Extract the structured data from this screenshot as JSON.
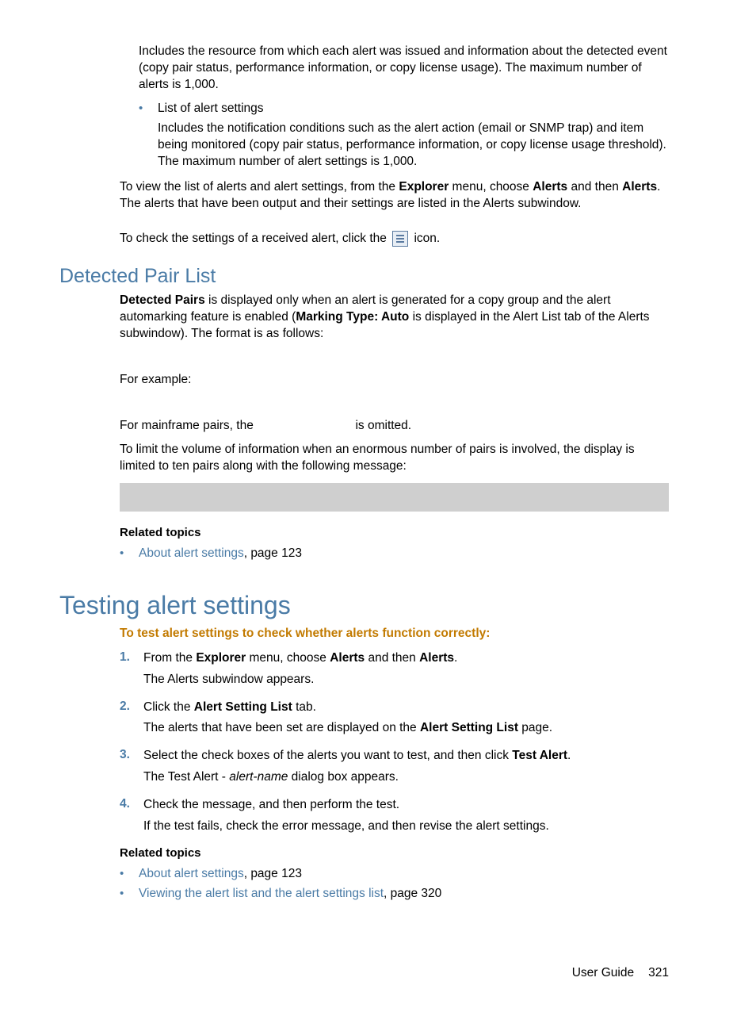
{
  "intro": {
    "para1": "Includes the resource from which each alert was issued and information about the detected event (copy pair status, performance information, or copy license usage). The maximum number of alerts is 1,000.",
    "bullet_label": "List of alert settings",
    "para2": "Includes the notification conditions such as the alert action (email or SNMP trap) and item being monitored (copy pair status, performance information, or copy license usage threshold). The maximum number of alert settings is 1,000.",
    "view_pre": "To view the list of alerts and alert settings, from the ",
    "explorer": "Explorer",
    "view_mid1": " menu, choose ",
    "alerts1": "Alerts",
    "view_mid2": " and then ",
    "alerts2": "Alerts",
    "view_post": ". The alerts that have been output and their settings are listed in the Alerts subwindow.",
    "check_pre": "To check the settings of a received alert, click the ",
    "check_post": " icon."
  },
  "detected": {
    "heading": "Detected Pair List",
    "p1_b1": "Detected Pairs",
    "p1_t1": " is displayed only when an alert is generated for a copy group and the alert automarking feature is enabled (",
    "p1_b2": "Marking Type: Auto",
    "p1_t2": " is displayed in the Alert List tab of the Alerts subwindow). The format is as follows:",
    "example": "For example:",
    "mainframe_pre": "For mainframe pairs, the ",
    "mainframe_post": " is omitted.",
    "limit": "To limit the volume of information when an enormous number of pairs is involved, the display is limited to ten pairs along with the following message:",
    "related_heading": "Related topics",
    "rel1_link": "About alert settings",
    "rel1_post": ", page 123"
  },
  "testing": {
    "heading": "Testing alert settings",
    "lead": "To test alert settings to check whether alerts function correctly:",
    "s1_num": "1.",
    "s1_pre": "From the ",
    "s1_b1": "Explorer",
    "s1_mid1": " menu, choose ",
    "s1_b2": "Alerts",
    "s1_mid2": " and then ",
    "s1_b3": "Alerts",
    "s1_post": ".",
    "s1_sub": "The Alerts subwindow appears.",
    "s2_num": "2.",
    "s2_pre": "Click the ",
    "s2_b1": "Alert Setting List",
    "s2_post": " tab.",
    "s2_sub_pre": "The alerts that have been set are displayed on the ",
    "s2_sub_b": "Alert Setting List",
    "s2_sub_post": " page.",
    "s3_num": "3.",
    "s3_pre": "Select the check boxes of the alerts you want to test, and then click ",
    "s3_b1": "Test Alert",
    "s3_post": ".",
    "s3_sub_pre": "The Test Alert - ",
    "s3_sub_i": "alert-name",
    "s3_sub_post": " dialog box appears.",
    "s4_num": "4.",
    "s4_text": "Check the message, and then perform the test.",
    "s4_sub": "If the test fails, check the error message, and then revise the alert settings.",
    "related_heading": "Related topics",
    "rel1_link": "About alert settings",
    "rel1_post": ", page 123",
    "rel2_link": "Viewing the alert list and the alert settings list",
    "rel2_post": ", page 320"
  },
  "footer": {
    "label": "User Guide",
    "page": "321"
  }
}
